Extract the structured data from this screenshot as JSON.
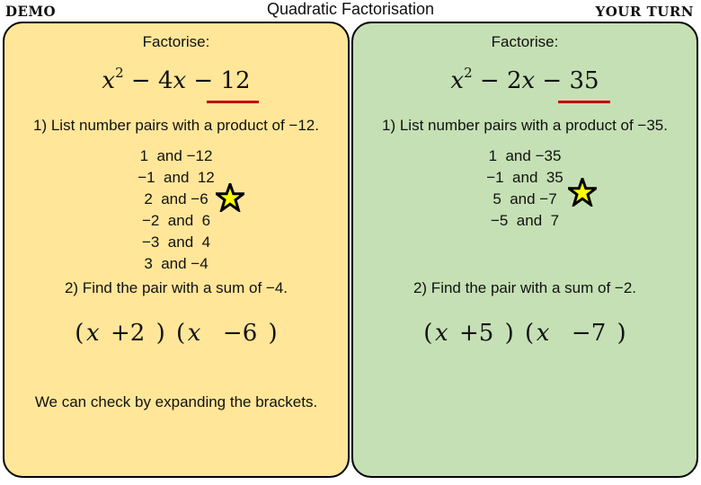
{
  "header": {
    "left_label": "DEMO",
    "title": "Quadratic Factorisation",
    "right_label": "YOUR TURN"
  },
  "demo": {
    "prompt": "Factorise:",
    "expression": {
      "b": "4",
      "c": "12"
    },
    "step1": "1) List number pairs with a product of −12.",
    "pairs": [
      "1  and −12",
      "−1  and  12",
      "2  and −6",
      "−2  and  6",
      "−3  and  4",
      "3  and −4"
    ],
    "starred_pair_index": 2,
    "step2": "2) Find the pair with a sum of −4.",
    "answer": {
      "first_sign": "+",
      "first_num": "2",
      "second_sign": "−",
      "second_num": "6"
    },
    "check_text": "We can check by expanding the brackets.",
    "background": "#ffe699"
  },
  "your_turn": {
    "prompt": "Factorise:",
    "expression": {
      "b": "2",
      "c": "35"
    },
    "step1": "1) List number pairs with a product of −35.",
    "pairs": [
      "1  and −35",
      "−1  and  35",
      "5  and −7",
      "−5  and  7"
    ],
    "starred_pair_index": 2,
    "step2": "2) Find the pair with a sum of −2.",
    "answer": {
      "first_sign": "+",
      "first_num": "5",
      "second_sign": "−",
      "second_num": "7"
    },
    "background": "#c5e0b4"
  },
  "colors": {
    "underline": "#c00000",
    "star_fill": "#ffff00",
    "star_stroke": "#000000"
  },
  "icons": {
    "star": "star-icon"
  }
}
